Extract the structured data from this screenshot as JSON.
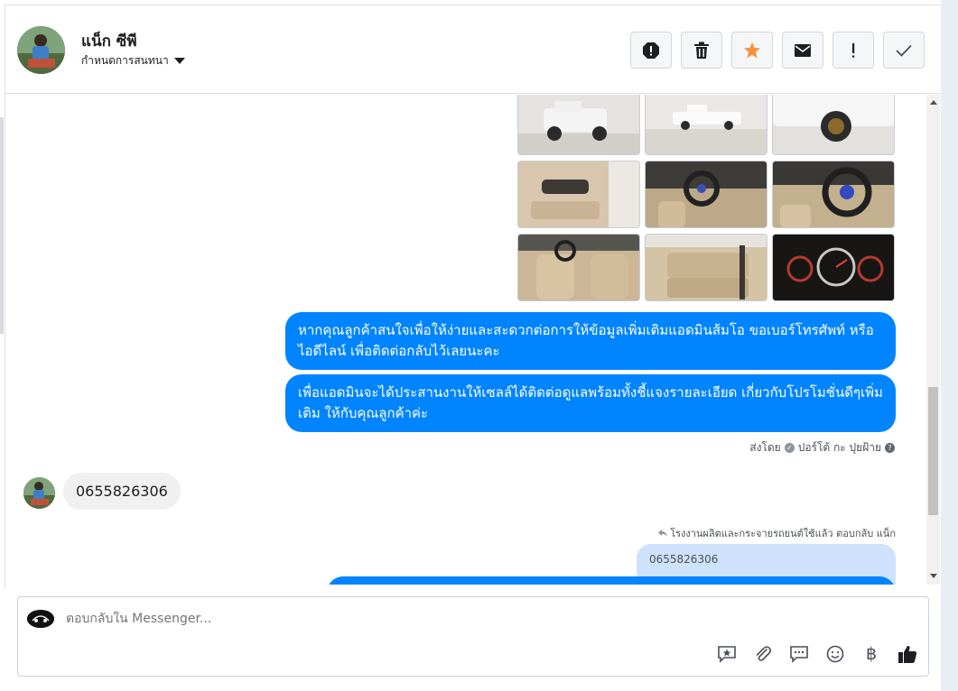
{
  "header": {
    "name": "แน็ก ซีพี",
    "assign_label": "กำหนดการสนทนา",
    "toolbar": [
      {
        "icon": "alert-circle-icon"
      },
      {
        "icon": "trash-icon"
      },
      {
        "icon": "star-icon",
        "color": "#f7923b"
      },
      {
        "icon": "envelope-icon"
      },
      {
        "icon": "exclamation-icon"
      },
      {
        "icon": "checkmark-icon"
      }
    ]
  },
  "conversation": {
    "messages_out": [
      "หากคุณลูกค้าสนใจเพื่อให้ง่ายและสะดวกต่อการให้ข้อมูลเพิ่มเติมแอดมินส้มโอ ขอเบอร์โทรศัพท์ หรือ ไอดีไลน์ เพื่อติดต่อกลับไว้เลยนะคะ",
      "เพื่อแอดมินจะได้ประสานงานให้เซลล์ได้ติดต่อดูแลพร้อมทั้งชี้แจงรายละเอียด เกี่ยวกับโปรโมชั่นดีๆเพิ่มเติม ให้กับคุณลูกค้าค่ะ"
    ],
    "sent_by": "ส่งโดย",
    "sent_by_name": "ปอร์โต้ กะ ปุยฝ้าย",
    "incoming": "0655826306",
    "reply_meta": "โรงงานผลิตและกระจายรถยนต์ใช้แล้ว ตอบกลับ แน็ก",
    "quoted": "0655826306"
  },
  "composer": {
    "placeholder": "ตอบกลับใน Messenger...",
    "tools": [
      "saved-reply-icon",
      "attachment-icon",
      "chat-bubble-icon",
      "emoji-icon",
      "baht-icon",
      "thumbs-up-icon"
    ]
  },
  "colors": {
    "accent_blue": "#0084ff",
    "incoming_gray": "#f1f0f0",
    "quote_blue": "#cfe2fb"
  }
}
